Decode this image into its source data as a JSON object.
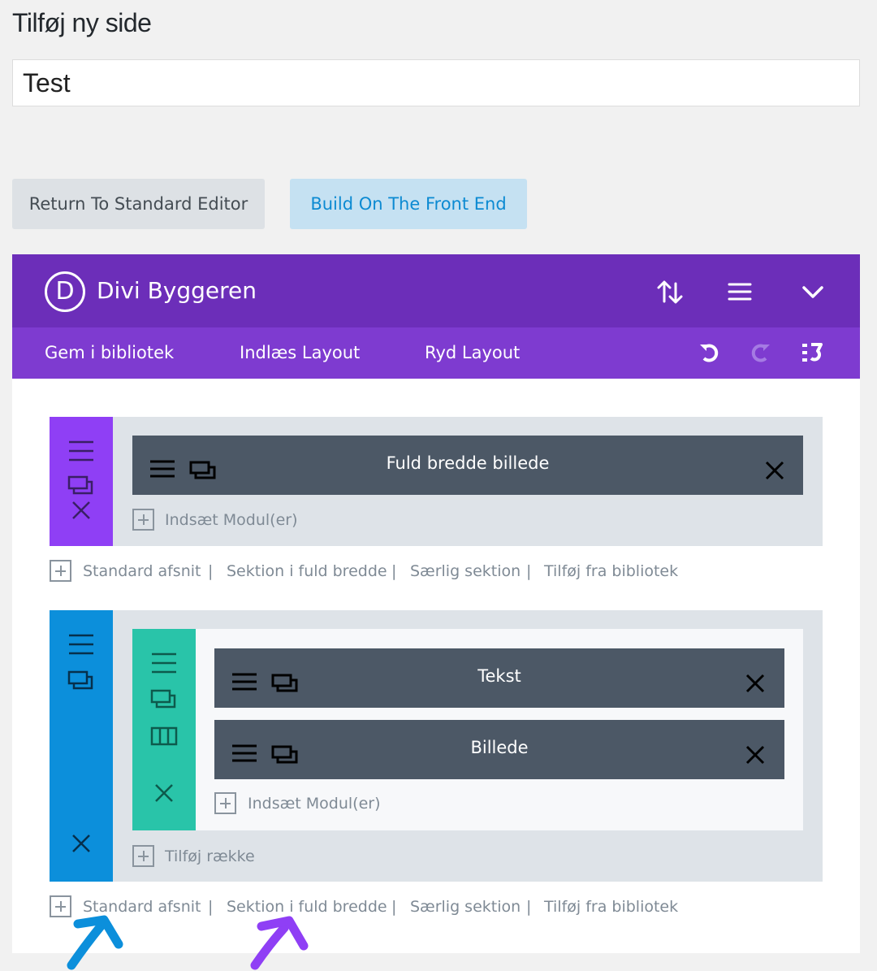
{
  "page": {
    "title": "Tilføj ny side",
    "post_title": "Test"
  },
  "buttons": {
    "standard_editor": "Return To Standard Editor",
    "front_end": "Build On The Front End"
  },
  "builder": {
    "logo_letter": "D",
    "title": "Divi Byggeren",
    "toolbar": {
      "save_library": "Gem i bibliotek",
      "load_layout": "Indlæs Layout",
      "clear_layout": "Ryd Layout"
    },
    "colors": {
      "header": "#6c2eb9",
      "toolbar": "#7e3bd0",
      "fullwidth_bar": "#8f3ff5",
      "standard_bar": "#0c8fdb",
      "row_bar": "#29c4a9",
      "module": "#4c5866"
    },
    "sections": [
      {
        "type": "fullwidth",
        "modules": [
          "Fuld bredde billede"
        ],
        "insert_label": "Indsæt Modul(er)"
      },
      {
        "type": "standard",
        "rows": [
          {
            "modules": [
              "Tekst",
              "Billede"
            ],
            "insert_label": "Indsæt Modul(er)"
          }
        ],
        "add_row_label": "Tilføj række"
      }
    ],
    "section_actions": {
      "standard": "Standard afsnit",
      "fullwidth": "Sektion i fuld bredde",
      "special": "Særlig sektion",
      "library": "Tilføj fra bibliotek",
      "separator": "|"
    }
  }
}
